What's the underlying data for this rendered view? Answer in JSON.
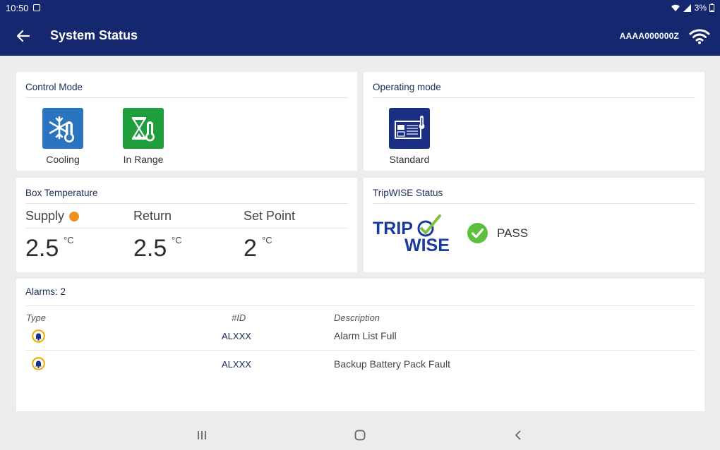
{
  "status_bar": {
    "time": "10:50",
    "battery": "3%"
  },
  "app_bar": {
    "title": "System Status",
    "device_id": "AAAA000000Z"
  },
  "control_mode": {
    "title": "Control Mode",
    "items": [
      {
        "label": "Cooling",
        "icon": "snowflake-thermometer-icon",
        "color": "#2a74c0"
      },
      {
        "label": "In Range",
        "icon": "hourglass-thermometer-icon",
        "color": "#1e9e3c"
      }
    ]
  },
  "operating_mode": {
    "title": "Operating mode",
    "label": "Standard",
    "icon": "reefer-unit-icon",
    "color": "#1a2e86"
  },
  "box_temperature": {
    "title": "Box Temperature",
    "supply": {
      "label": "Supply",
      "value": "2.5",
      "unit": "°C",
      "indicator_color": "#f0901e"
    },
    "return": {
      "label": "Return",
      "value": "2.5",
      "unit": "°C"
    },
    "set_point": {
      "label": "Set Point",
      "value": "2",
      "unit": "°C"
    }
  },
  "tripwise": {
    "title": "TripWISE Status",
    "logo_text_top": "TRIP",
    "logo_text_bottom": "WISE",
    "status": "PASS"
  },
  "alarms": {
    "title_prefix": "Alarms: ",
    "count": "2",
    "headers": {
      "type": "Type",
      "id": "#ID",
      "description": "Description"
    },
    "rows": [
      {
        "id": "ALXXX",
        "description": "Alarm List Full"
      },
      {
        "id": "ALXXX",
        "description": "Backup Battery Pack Fault"
      }
    ]
  }
}
